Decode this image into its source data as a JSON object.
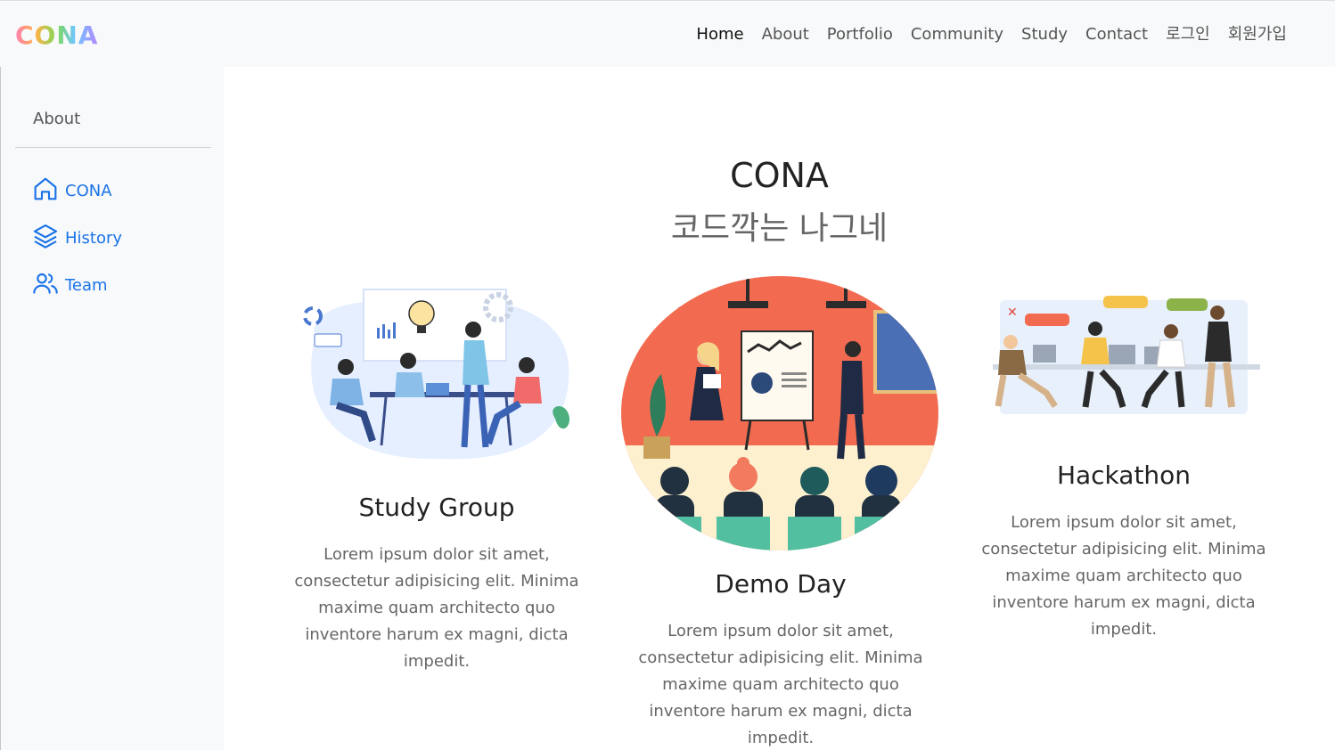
{
  "brand": {
    "logo": "CONA"
  },
  "nav": {
    "items": [
      "Home",
      "About",
      "Portfolio",
      "Community",
      "Study",
      "Contact",
      "로그인",
      "회원가입"
    ],
    "active": "Home"
  },
  "sidebar": {
    "title": "About",
    "items": [
      {
        "label": "CONA",
        "icon": "home-icon"
      },
      {
        "label": "History",
        "icon": "layers-icon"
      },
      {
        "label": "Team",
        "icon": "users-icon"
      }
    ]
  },
  "hero": {
    "title": "CONA",
    "subtitle": "코드깍는 나그네"
  },
  "cards": [
    {
      "title": "Study Group",
      "text": "Lorem ipsum dolor sit amet, consectetur adipisicing elit. Minima maxime quam architecto quo inventore harum ex magni, dicta impedit.",
      "illustration": "study-group-illustration"
    },
    {
      "title": "Demo Day",
      "text": "Lorem ipsum dolor sit amet, consectetur adipisicing elit. Minima maxime quam architecto quo inventore harum ex magni, dicta impedit.",
      "illustration": "demo-day-illustration"
    },
    {
      "title": "Hackathon",
      "text": "Lorem ipsum dolor sit amet, consectetur adipisicing elit. Minima maxime quam architecto quo inventore harum ex magni, dicta impedit.",
      "illustration": "hackathon-illustration"
    }
  ],
  "colors": {
    "accent": "#1a73e8",
    "demo_bg": "#f26b50",
    "floor": "#fdf0cf"
  }
}
